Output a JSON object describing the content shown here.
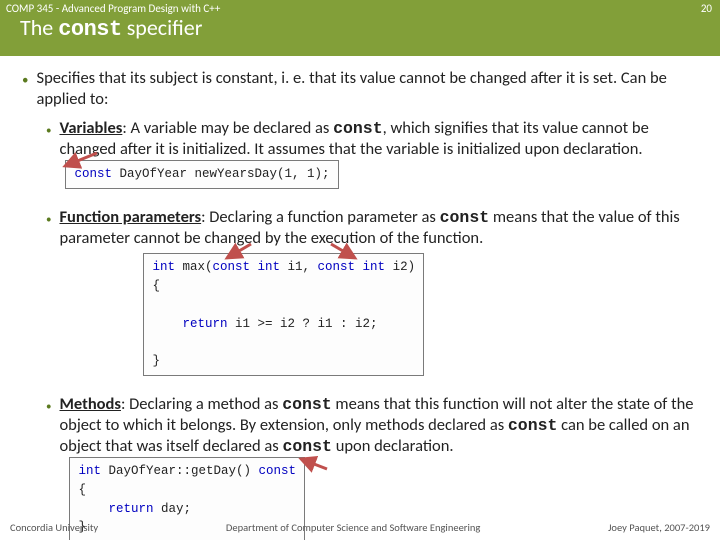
{
  "header": {
    "course": "COMP 345 - Advanced Program Design with C++",
    "page": "20",
    "title_pre": "The ",
    "title_kw": "const",
    "title_post": " specifier"
  },
  "intro": "Specifies that its subject is constant, i. e. that its value cannot be changed after it is set. Can be applied to:",
  "items": [
    {
      "term": "Variables",
      "pre": ": A variable may be declared as ",
      "kw": "const",
      "post": ", which signifies that its value cannot be changed after it is initialized. It assumes that the variable is initialized upon declaration.",
      "code": "const DayOfYear newYearsDay(1, 1);"
    },
    {
      "term": "Function parameters",
      "pre": ": Declaring a function parameter as ",
      "kw": "const",
      "post": " means that the value of this parameter cannot be changed by the execution of the function.",
      "code_lines": [
        "int max(const int i1, const int i2)",
        "{",
        "",
        "    return i1 >= i2 ? i1 : i2;",
        "",
        "}"
      ]
    },
    {
      "term": "Methods",
      "pre": ": Declaring a method as ",
      "kw": "const",
      "post1": "  means that this function will not alter the state of the object to which it belongs. By extension, only methods declared as ",
      "kw2": "const",
      "post2": " can be called on an object that was itself declared as ",
      "kw3": "const",
      "post3": " upon declaration.",
      "code_lines": [
        "int DayOfYear::getDay() const",
        "{",
        "    return day;",
        "}"
      ]
    }
  ],
  "footer": {
    "left": "Concordia University",
    "center": "Department of Computer Science and Software Engineering",
    "right": "Joey Paquet, 2007-2019"
  }
}
